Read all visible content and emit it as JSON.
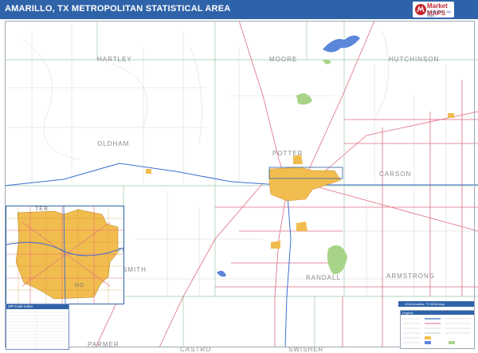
{
  "title": "AMARILLO, TX METROPOLITAN STATISTICAL AREA",
  "brand": {
    "name": "Market MAPS",
    "tagline": "Go Beyond... the Maps",
    "subtagline": "America's Leading Source of Business Maps",
    "logo_icon": "marketmaps-logo-icon"
  },
  "counties": {
    "hartley": "HARTLEY",
    "moore": "MOORE",
    "hutchinson": "HUTCHINSON",
    "oldham": "OLDHAM",
    "potter": "POTTER",
    "carson": "CARSON",
    "deaf_smith": "SMITH",
    "randall": "RANDALL",
    "armstrong": "ARMSTRONG",
    "parmer": "PARMER",
    "castro": "CASTRO",
    "swisher": "SWISHER"
  },
  "inset": {
    "label_top": "TER",
    "label_right_1": "TH",
    "label_right_2": "ND"
  },
  "zip_index": {
    "title": "ZIP Code Index"
  },
  "legend": {
    "title": "Legend"
  },
  "bottom_bar": "2018 Amarillo, TX MSA Map",
  "colors": {
    "header": "#2f63a9",
    "city": "#f2bd4f",
    "interstate": "#3b6fd1",
    "highway": "#e06b80",
    "county_line": "#9bc9a8",
    "water": "#5b86d9",
    "park": "#a8d48a"
  }
}
